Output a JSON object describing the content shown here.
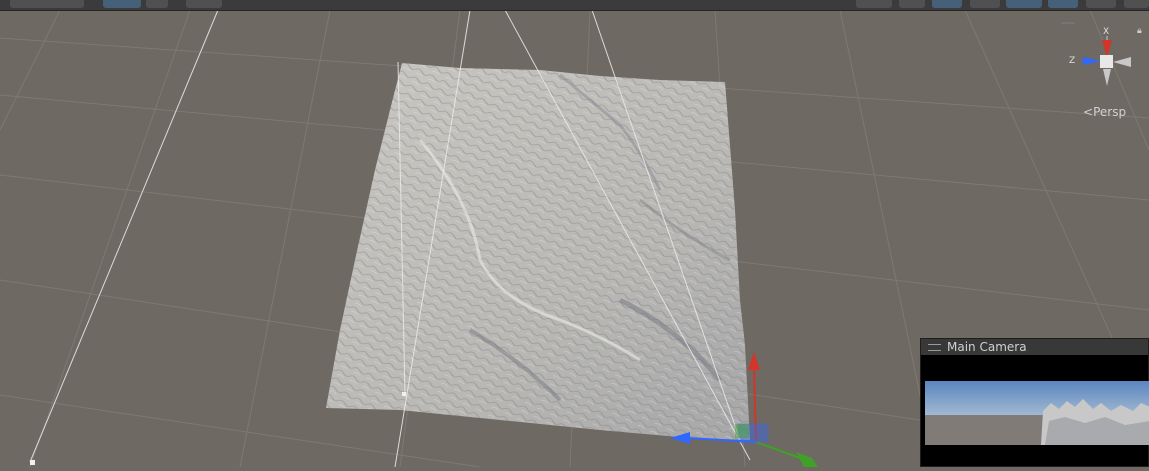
{
  "toolbar": {
    "buttons": [
      "layers-dropdown",
      "tool-handle",
      "pivot-toggle",
      "snap-increment",
      "gizmos",
      "scene-view-settings",
      "camera-toggle",
      "lighting-toggle",
      "fx-toggle",
      "search-icon",
      "2d-toggle"
    ]
  },
  "scene": {
    "view_mode": "Persp",
    "axis_labels": {
      "x": "X",
      "z": "Z"
    }
  },
  "preview": {
    "title": "Main Camera"
  },
  "colors": {
    "grid_bg": "#6e6963",
    "x_axis": "#d0362a",
    "y_axis": "#40a028",
    "z_axis": "#3068ff",
    "toolbar": "#3b3b3b"
  }
}
